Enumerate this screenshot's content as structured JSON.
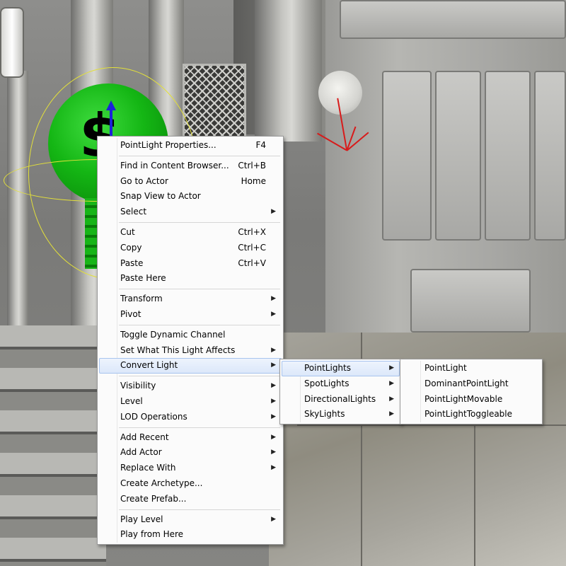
{
  "main_menu": {
    "groups": [
      [
        {
          "label": "PointLight Properties...",
          "shortcut": "F4",
          "submenu": false
        }
      ],
      [
        {
          "label": "Find in Content Browser...",
          "shortcut": "Ctrl+B",
          "submenu": false
        },
        {
          "label": "Go to Actor",
          "shortcut": "Home",
          "submenu": false
        },
        {
          "label": "Snap View to Actor",
          "shortcut": "",
          "submenu": false
        },
        {
          "label": "Select",
          "shortcut": "",
          "submenu": true
        }
      ],
      [
        {
          "label": "Cut",
          "shortcut": "Ctrl+X",
          "submenu": false
        },
        {
          "label": "Copy",
          "shortcut": "Ctrl+C",
          "submenu": false
        },
        {
          "label": "Paste",
          "shortcut": "Ctrl+V",
          "submenu": false
        },
        {
          "label": "Paste Here",
          "shortcut": "",
          "submenu": false
        }
      ],
      [
        {
          "label": "Transform",
          "shortcut": "",
          "submenu": true
        },
        {
          "label": "Pivot",
          "shortcut": "",
          "submenu": true
        }
      ],
      [
        {
          "label": "Toggle Dynamic Channel",
          "shortcut": "",
          "submenu": false
        },
        {
          "label": "Set What This Light Affects",
          "shortcut": "",
          "submenu": true
        },
        {
          "label": "Convert Light",
          "shortcut": "",
          "submenu": true,
          "highlighted": true
        }
      ],
      [
        {
          "label": "Visibility",
          "shortcut": "",
          "submenu": true
        },
        {
          "label": "Level",
          "shortcut": "",
          "submenu": true
        },
        {
          "label": "LOD Operations",
          "shortcut": "",
          "submenu": true
        }
      ],
      [
        {
          "label": "Add Recent",
          "shortcut": "",
          "submenu": true
        },
        {
          "label": "Add Actor",
          "shortcut": "",
          "submenu": true
        },
        {
          "label": "Replace With",
          "shortcut": "",
          "submenu": true
        },
        {
          "label": "Create Archetype...",
          "shortcut": "",
          "submenu": false
        },
        {
          "label": "Create Prefab...",
          "shortcut": "",
          "submenu": false
        }
      ],
      [
        {
          "label": "Play Level",
          "shortcut": "",
          "submenu": true
        },
        {
          "label": "Play from Here",
          "shortcut": "",
          "submenu": false
        }
      ]
    ]
  },
  "convert_light_menu": {
    "items": [
      {
        "label": "PointLights",
        "submenu": true,
        "highlighted": true
      },
      {
        "label": "SpotLights",
        "submenu": true
      },
      {
        "label": "DirectionalLights",
        "submenu": true
      },
      {
        "label": "SkyLights",
        "submenu": true
      }
    ]
  },
  "pointlights_menu": {
    "items": [
      {
        "label": "PointLight"
      },
      {
        "label": "DominantPointLight"
      },
      {
        "label": "PointLightMovable"
      },
      {
        "label": "PointLightToggleable"
      }
    ]
  },
  "scene": {
    "actor_glyph": "$",
    "colors": {
      "actor_sprite": "#14b614",
      "gizmo_ring": "#e3e03a",
      "gizmo_axis_z": "#1c22d8",
      "light_rays": "#d81b1b",
      "menu_highlight": "#dbe7fa"
    }
  }
}
